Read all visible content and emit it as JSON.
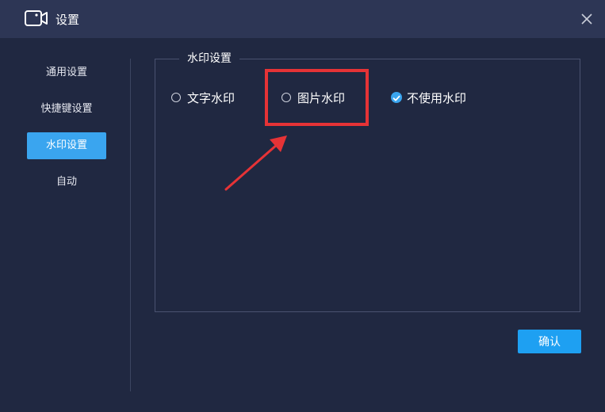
{
  "window": {
    "title": "设置",
    "app_icon": "video-camera-icon",
    "close_icon": "close-icon"
  },
  "sidebar": {
    "items": [
      {
        "label": "通用设置",
        "active": false
      },
      {
        "label": "快捷键设置",
        "active": false
      },
      {
        "label": "水印设置",
        "active": true
      },
      {
        "label": "自动",
        "active": false
      }
    ]
  },
  "watermark": {
    "group_title": "水印设置",
    "options": [
      {
        "label": "文字水印",
        "checked": false
      },
      {
        "label": "图片水印",
        "checked": false
      },
      {
        "label": "不使用水印",
        "checked": true
      }
    ]
  },
  "footer": {
    "confirm_label": "确认"
  },
  "annotation": {
    "highlight_color": "#e63336"
  },
  "colors": {
    "accent": "#3aa5ef",
    "background": "#202841",
    "titlebar": "#2d3655"
  }
}
